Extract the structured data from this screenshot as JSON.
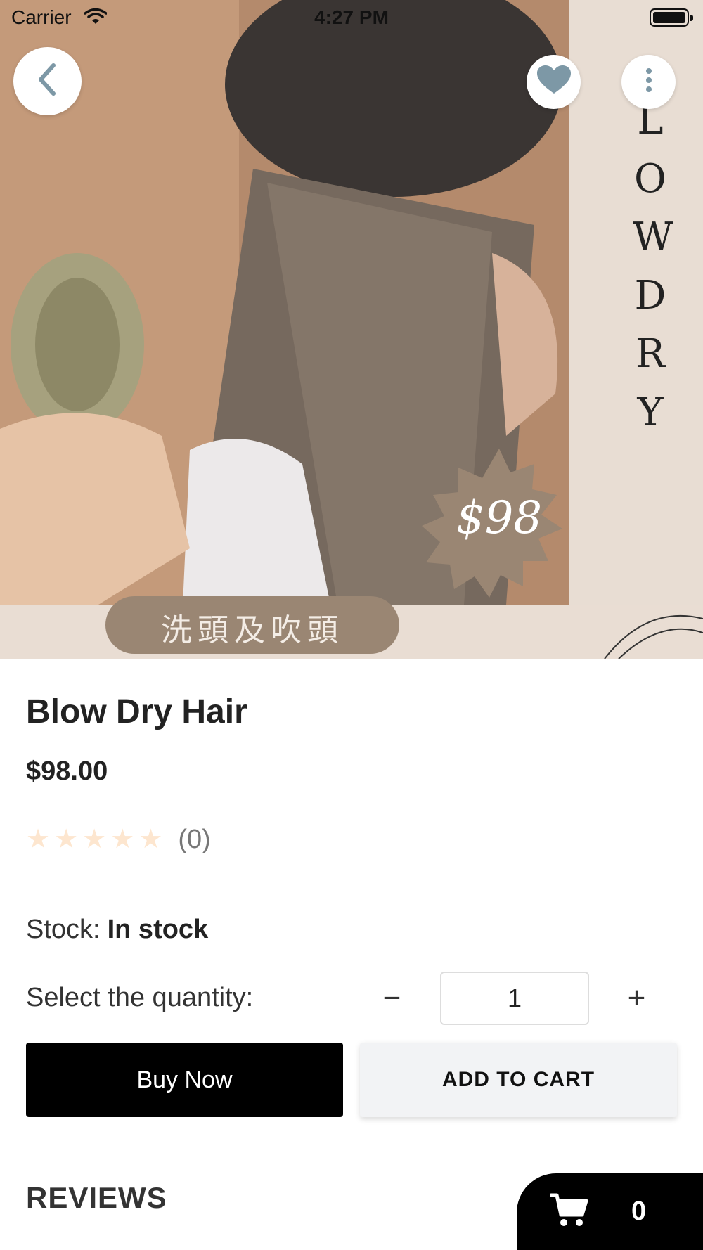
{
  "status_bar": {
    "carrier": "Carrier",
    "time": "4:27 PM"
  },
  "hero": {
    "side_text": "LOW DRY",
    "badge_price": "$98",
    "bottom_label": "洗頭及吹頭"
  },
  "product": {
    "title": "Blow Dry Hair",
    "price": "$98.00",
    "rating": 0,
    "rating_count": "(0)",
    "stock_label": "Stock:",
    "stock_value": "In stock",
    "quantity_label": "Select the quantity:",
    "quantity_minus": "−",
    "quantity_plus": "+",
    "quantity": "1"
  },
  "actions": {
    "buy_now": "Buy Now",
    "add_to_cart": "ADD TO CART"
  },
  "sections": {
    "reviews": "REVIEWS"
  },
  "cart": {
    "count": "0"
  },
  "colors": {
    "star_empty": "#fde6cf",
    "fav_icon": "#7d98a6",
    "buy_bg": "#000000",
    "cart_bg": "#f2f3f5"
  },
  "icons": {
    "back": "chevron-left-icon",
    "favorite": "heart-icon",
    "more": "more-vertical-icon",
    "cart": "shopping-cart-icon"
  }
}
